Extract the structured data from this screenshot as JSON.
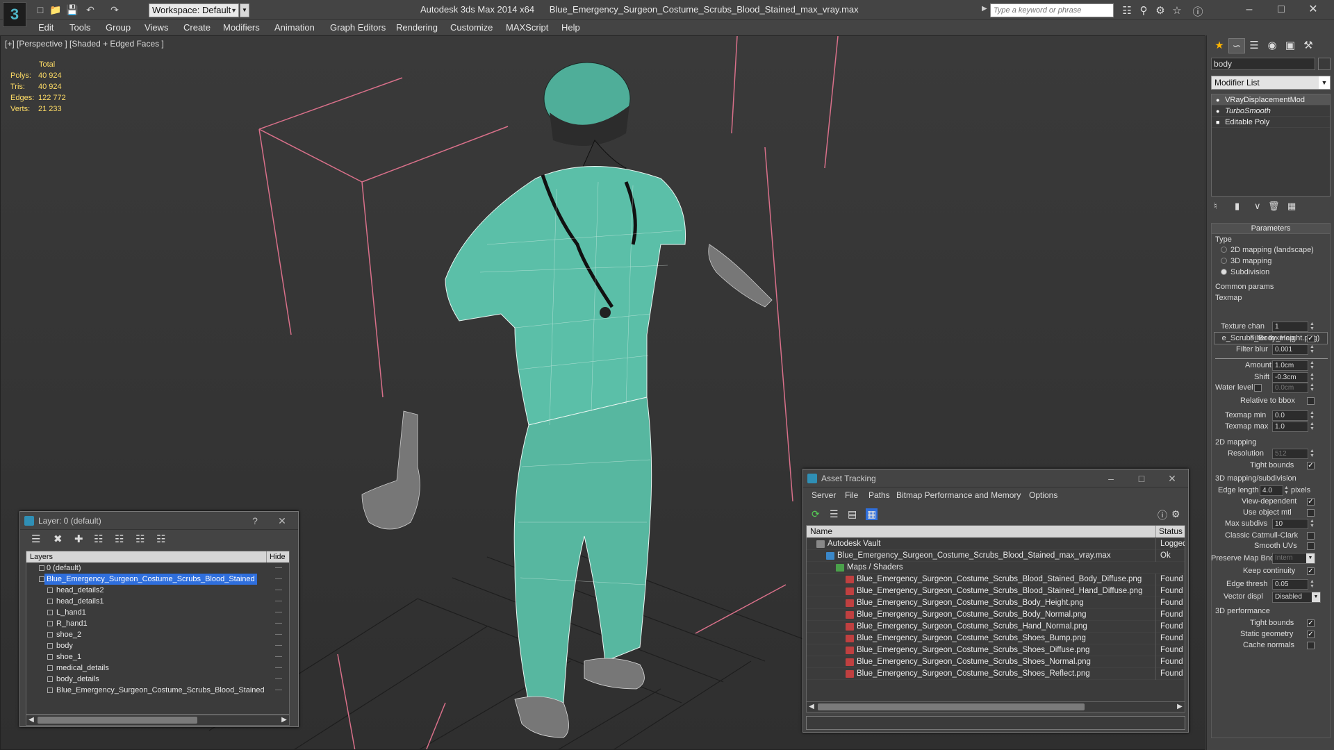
{
  "app": {
    "logo": "3",
    "workspace": "Workspace: Default",
    "title": "Autodesk 3ds Max 2014 x64",
    "filename": "Blue_Emergency_Surgeon_Costume_Scrubs_Blood_Stained_max_vray.max",
    "search_placeholder": "Type a keyword or phrase"
  },
  "quick_access_icons": [
    "new-file-icon",
    "open-folder-icon",
    "save-icon",
    "undo-icon",
    "redo-icon"
  ],
  "menu": [
    "Edit",
    "Tools",
    "Group",
    "Views",
    "Create",
    "Modifiers",
    "Animation",
    "Graph Editors",
    "Rendering",
    "Customize",
    "MAXScript",
    "Help"
  ],
  "viewport": {
    "label": "[+] [Perspective ] [Shaded + Edged Faces ]",
    "stats": {
      "header": "Total",
      "rows": [
        {
          "label": "Polys:",
          "value": "40 924"
        },
        {
          "label": "Tris:",
          "value": "40 924"
        },
        {
          "label": "Edges:",
          "value": "122 772"
        },
        {
          "label": "Verts:",
          "value": "21 233"
        }
      ]
    }
  },
  "command_panel": {
    "object_name": "body",
    "modifier_list": "Modifier List",
    "stack": [
      "VRayDisplacementMod",
      "TurboSmooth",
      "Editable Poly"
    ],
    "parameters": {
      "header": "Parameters",
      "type_label": "Type",
      "type_options": [
        "2D mapping (landscape)",
        "3D mapping",
        "Subdivision"
      ],
      "type_selected": 2,
      "common_params": "Common params",
      "texmap_label": "Texmap",
      "texmap_value": "e_Scrubs_Body_Height.png)",
      "texture_chan_label": "Texture chan",
      "texture_chan": "1",
      "filter_texmap_label": "Filter texmap",
      "filter_blur_label": "Filter blur",
      "filter_blur": "0.001",
      "amount_label": "Amount",
      "amount": "1.0cm",
      "shift_label": "Shift",
      "shift": "-0.3cm",
      "water_level_label": "Water level",
      "water_level": "0.0cm",
      "relative_bbox_label": "Relative to bbox",
      "texmap_min_label": "Texmap min",
      "texmap_min": "0.0",
      "texmap_max_label": "Texmap max",
      "texmap_max": "1.0",
      "mapping2d_label": "2D mapping",
      "resolution_label": "Resolution",
      "resolution": "512",
      "tight_bounds_label": "Tight bounds",
      "mapping3d_label": "3D mapping/subdivision",
      "edge_length_label": "Edge length",
      "edge_length": "4.0",
      "pixels_label": "pixels",
      "view_dependent_label": "View-dependent",
      "use_object_mtl_label": "Use object mtl",
      "max_subdivs_label": "Max subdivs",
      "max_subdivs": "10",
      "classic_catmull_label": "Classic Catmull-Clark",
      "smooth_uvs_label": "Smooth UVs",
      "preserve_map_bnd_label": "Preserve Map Bnd",
      "preserve_map_bnd": "Intern",
      "keep_continuity_label": "Keep continuity",
      "edge_thresh_label": "Edge thresh",
      "edge_thresh": "0.05",
      "vector_displ_label": "Vector displ",
      "vector_displ": "Disabled",
      "perf_label": "3D performance",
      "perf_tight_bounds_label": "Tight bounds",
      "static_geometry_label": "Static geometry",
      "cache_normals_label": "Cache normals"
    }
  },
  "layer_window": {
    "title": "Layer: 0 (default)",
    "col_layers": "Layers",
    "col_hide": "Hide",
    "rows": [
      {
        "name": "0 (default)",
        "indent": 0
      },
      {
        "name": "Blue_Emergency_Surgeon_Costume_Scrubs_Blood_Stained",
        "indent": 0,
        "selected": true
      },
      {
        "name": "head_details2",
        "indent": 1
      },
      {
        "name": "head_details1",
        "indent": 1
      },
      {
        "name": "L_hand1",
        "indent": 1
      },
      {
        "name": "R_hand1",
        "indent": 1
      },
      {
        "name": "shoe_2",
        "indent": 1
      },
      {
        "name": "body",
        "indent": 1
      },
      {
        "name": "shoe_1",
        "indent": 1
      },
      {
        "name": "medical_details",
        "indent": 1
      },
      {
        "name": "body_details",
        "indent": 1
      },
      {
        "name": "Blue_Emergency_Surgeon_Costume_Scrubs_Blood_Stained",
        "indent": 1
      }
    ]
  },
  "asset_window": {
    "title": "Asset Tracking",
    "menu": [
      "Server",
      "File",
      "Paths",
      "Bitmap Performance and Memory",
      "Options"
    ],
    "col_name": "Name",
    "col_status": "Status",
    "rows": [
      {
        "name": "Autodesk Vault",
        "status": "Logged",
        "indent": 1,
        "icon": "vault"
      },
      {
        "name": "Blue_Emergency_Surgeon_Costume_Scrubs_Blood_Stained_max_vray.max",
        "status": "Ok",
        "indent": 2,
        "icon": "max"
      },
      {
        "name": "Maps / Shaders",
        "status": "",
        "indent": 3,
        "icon": "maps"
      },
      {
        "name": "Blue_Emergency_Surgeon_Costume_Scrubs_Blood_Stained_Body_Diffuse.png",
        "status": "Found",
        "indent": 4,
        "icon": "png"
      },
      {
        "name": "Blue_Emergency_Surgeon_Costume_Scrubs_Blood_Stained_Hand_Diffuse.png",
        "status": "Found",
        "indent": 4,
        "icon": "png"
      },
      {
        "name": "Blue_Emergency_Surgeon_Costume_Scrubs_Body_Height.png",
        "status": "Found",
        "indent": 4,
        "icon": "png"
      },
      {
        "name": "Blue_Emergency_Surgeon_Costume_Scrubs_Body_Normal.png",
        "status": "Found",
        "indent": 4,
        "icon": "png"
      },
      {
        "name": "Blue_Emergency_Surgeon_Costume_Scrubs_Hand_Normal.png",
        "status": "Found",
        "indent": 4,
        "icon": "png"
      },
      {
        "name": "Blue_Emergency_Surgeon_Costume_Scrubs_Shoes_Bump.png",
        "status": "Found",
        "indent": 4,
        "icon": "png"
      },
      {
        "name": "Blue_Emergency_Surgeon_Costume_Scrubs_Shoes_Diffuse.png",
        "status": "Found",
        "indent": 4,
        "icon": "png"
      },
      {
        "name": "Blue_Emergency_Surgeon_Costume_Scrubs_Shoes_Normal.png",
        "status": "Found",
        "indent": 4,
        "icon": "png"
      },
      {
        "name": "Blue_Emergency_Surgeon_Costume_Scrubs_Shoes_Reflect.png",
        "status": "Found",
        "indent": 4,
        "icon": "png"
      }
    ]
  },
  "colors": {
    "mesh": "#5bbfa8",
    "selection": "#2f6fdd",
    "bbox": "#d9708a",
    "stats": "#ffdd66"
  }
}
